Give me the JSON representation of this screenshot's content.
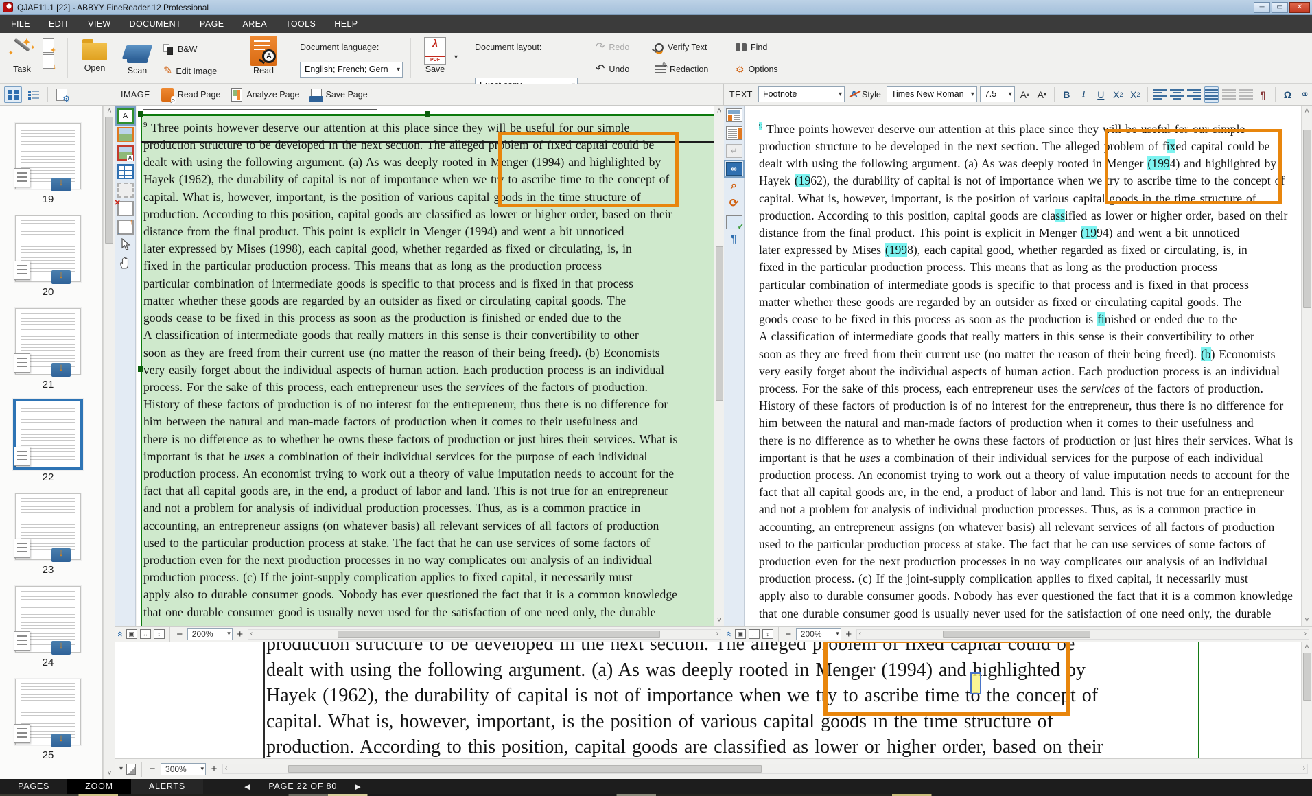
{
  "window": {
    "title": "QJAE11.1 [22] - ABBYY FineReader 12 Professional"
  },
  "menu": [
    "FILE",
    "EDIT",
    "VIEW",
    "DOCUMENT",
    "PAGE",
    "AREA",
    "TOOLS",
    "HELP"
  ],
  "toolbar": {
    "task": "Task",
    "open": "Open",
    "scan": "Scan",
    "bw": "B&W",
    "edit_image": "Edit Image",
    "read": "Read",
    "doc_language_label": "Document language:",
    "doc_language_value": "English; French; Gern",
    "save": "Save",
    "doc_layout_label": "Document layout:",
    "doc_layout_value": "Exact copy",
    "redo": "Redo",
    "undo": "Undo",
    "verify_text": "Verify Text",
    "redaction": "Redaction",
    "find": "Find",
    "options": "Options"
  },
  "panes": {
    "image": {
      "title": "IMAGE",
      "read_page": "Read Page",
      "analyze_page": "Analyze Page",
      "save_page": "Save Page",
      "zoom": "200%"
    },
    "text": {
      "title": "TEXT",
      "preset": "Footnote",
      "style": "Style",
      "font": "Times New Roman",
      "size": "7.5",
      "zoom": "200%"
    },
    "zoom": {
      "zoom": "300%"
    }
  },
  "status": {
    "tabs": [
      "PAGES",
      "ZOOM",
      "ALERTS"
    ],
    "active_tab": "ZOOM",
    "page_nav": "PAGE 22 OF 80"
  },
  "thumbnails": {
    "pages": [
      "19",
      "20",
      "21",
      "22",
      "23",
      "24",
      "25"
    ],
    "selected": "22"
  },
  "glyphs": {
    "dropdown": "▾",
    "minus": "−",
    "plus": "+",
    "left": "‹",
    "right": "›",
    "up": "˄",
    "down": "˅",
    "chevron": "«",
    "undo": "↶",
    "redo": "↷",
    "prev": "◀",
    "next": "▶",
    "omega": "Ω",
    "pilcrow": "¶",
    "refresh": "⟳",
    "return": "↵",
    "pencil": "✎",
    "gear": "⚙",
    "harrow": "↔",
    "varrow": "↕",
    "two": "2",
    "a": "A",
    "x": "X",
    "b": "B",
    "i": "I",
    "u": "U",
    "down_arrow": "↓",
    "star": "✦",
    "search": "⌕",
    "link": "⚭",
    "inf": "∞",
    "a_up": "A",
    "a_dn": "A"
  },
  "colors": {
    "accent_orange": "#E8860D",
    "highlight_cyan": "#7DF3F0",
    "zone_green_bg": "#CFE9CC",
    "zone_green_border": "#0C7A0C",
    "selection_blue": "#2E74B5",
    "titlebar_blue": "#AEC7E0",
    "menubar_dark": "#3B3B3B",
    "statusbar_dark": "#1D1D1D"
  },
  "footnote_lines": [
    [
      {
        "t": "9",
        "s": "sup hl"
      },
      {
        "t": " Three points however deserve our attention at this place since they will be useful for our simple"
      }
    ],
    [
      {
        "t": "production structure to be developed in the next section. The alleged problem of f"
      },
      {
        "t": "ix",
        "s": "hl"
      },
      {
        "t": "ed capital could be"
      }
    ],
    [
      {
        "t": "dealt with using the following argument. (a) As was deeply rooted in Menger "
      },
      {
        "t": "(199",
        "s": "hl"
      },
      {
        "t": "4) and highlighted by"
      }
    ],
    [
      {
        "t": "Hayek "
      },
      {
        "t": "(19",
        "s": "hl"
      },
      {
        "t": "62), the durability of capital is not of importance when we try to ascribe time to the concept of"
      }
    ],
    [
      {
        "t": "capital. What is, however, important, is the position of various capital goods in the time structure of"
      }
    ],
    [
      {
        "t": "production. According to this position, capital goods are cla"
      },
      {
        "t": "ss",
        "s": "hl"
      },
      {
        "t": "ified as lower or higher order, based on their"
      }
    ],
    [
      {
        "t": "distance from the final product. This point is explicit in Menger "
      },
      {
        "t": "(19",
        "s": "hl"
      },
      {
        "t": "94) and went a bit unnoticed"
      }
    ],
    [
      {
        "t": "later expressed by Mises "
      },
      {
        "t": "(199",
        "s": "hl"
      },
      {
        "t": "8), each capital good, whether regarded as fixed or circulating, is, in"
      }
    ],
    [
      {
        "t": "fixed in the particular production process. This means that as long as the production process"
      }
    ],
    [
      {
        "t": "particular combination of intermediate goods is specific to that process and is fixed in that process"
      }
    ],
    [
      {
        "t": "matter whether these goods are regarded by an outsider as fixed or circulating capital goods. The"
      }
    ],
    [
      {
        "t": "goods cease to be fixed in this process as soon as the production is "
      },
      {
        "t": "fi",
        "s": "hl"
      },
      {
        "t": "nished or ended due to the"
      }
    ],
    [
      {
        "t": "A classification of intermediate goods that really matters in this sense is their convertibility to other"
      }
    ],
    [
      {
        "t": "soon as they are freed from their current use (no matter the reason of their being freed). "
      },
      {
        "t": "(b",
        "s": "hl"
      },
      {
        "t": ") Economists"
      }
    ],
    [
      {
        "t": "very easily forget about the individual aspects of human action. Each production process is an individual"
      }
    ],
    [
      {
        "t": "process. For the sake of this process, each entrepreneur uses the "
      },
      {
        "t": "services",
        "s": "i"
      },
      {
        "t": " of the factors of production."
      }
    ],
    [
      {
        "t": "History of these factors of production is of no interest for the entrepreneur, thus there is no difference for"
      }
    ],
    [
      {
        "t": "him between the natural and man-made factors of production when it comes to their usefulness and"
      }
    ],
    [
      {
        "t": "there is no difference as to whether he owns these factors of production or just hires their services. What is"
      }
    ],
    [
      {
        "t": "important is that he "
      },
      {
        "t": "uses",
        "s": "i"
      },
      {
        "t": " a combination of their individual services for the purpose of each individual"
      }
    ],
    [
      {
        "t": "production process. An economist trying to work out a theory of value imputation needs to account for the"
      }
    ],
    [
      {
        "t": "fact that all capital goods are, in the end, a product of labor and land. This is not true for an entrepreneur"
      }
    ],
    [
      {
        "t": "and not a problem for analysis of individual production processes. Thus, as is a common practice in"
      }
    ],
    [
      {
        "t": "accounting, an entrepreneur assigns (on whatever basis) all relevant services of all factors of production"
      }
    ],
    [
      {
        "t": "used to the particular production process at stake. The fact that he can use services of some factors of"
      }
    ],
    [
      {
        "t": "production even for the next production processes in no way complicates our analysis of an individual"
      }
    ],
    [
      {
        "t": "production process. (c) If the joint-supply complication applies to fixed capital, it necessarily must"
      }
    ],
    [
      {
        "t": "apply also to durable consumer goods. Nobody has ever questioned the fact that it is a common knowledge"
      }
    ],
    [
      {
        "t": "that one durable consumer good is usually never used for the satisfaction of one need only, the durable"
      }
    ]
  ]
}
